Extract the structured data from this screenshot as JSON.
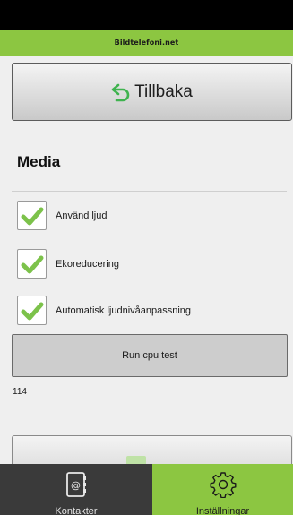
{
  "header": {
    "brand": "Bildtelefoni.net"
  },
  "back_button": {
    "label": "Tillbaka",
    "icon": "back-arrow-icon",
    "icon_color": "#3fb34f"
  },
  "media": {
    "title": "Media",
    "options": [
      {
        "label": "Använd ljud",
        "checked": true
      },
      {
        "label": "Ekoreducering",
        "checked": true
      },
      {
        "label": "Automatisk ljudnivåanpassning",
        "checked": true
      }
    ]
  },
  "cpu_test": {
    "label": "Run cpu test",
    "result": "114"
  },
  "tabs": [
    {
      "label": "Kontakter",
      "icon": "address-book-icon",
      "active": false
    },
    {
      "label": "Inställningar",
      "icon": "gear-icon",
      "active": true
    }
  ],
  "colors": {
    "accent": "#8cc641",
    "check": "#7cc24a",
    "tab_inactive": "#3a3a3a"
  }
}
